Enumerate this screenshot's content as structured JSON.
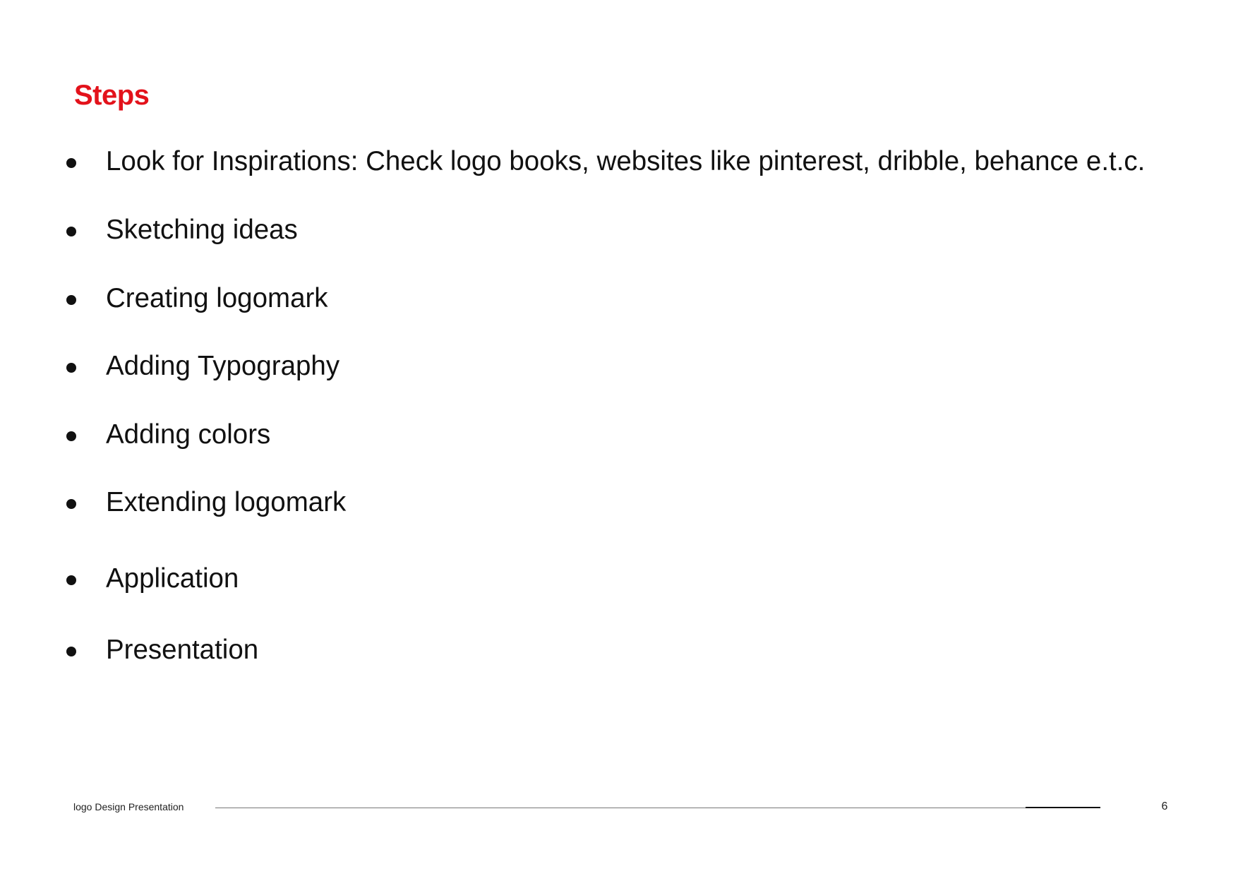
{
  "title": "Steps",
  "title_color": "#e3121b",
  "steps": [
    "Look for Inspirations: Check logo books, websites like pinterest, dribble, behance e.t.c.",
    "Sketching ideas",
    "Creating logomark",
    "Adding Typography",
    "Adding colors",
    "Extending logomark",
    "Application",
    "Presentation"
  ],
  "footer": {
    "label": "logo Design Presentation",
    "page_number": "6"
  }
}
